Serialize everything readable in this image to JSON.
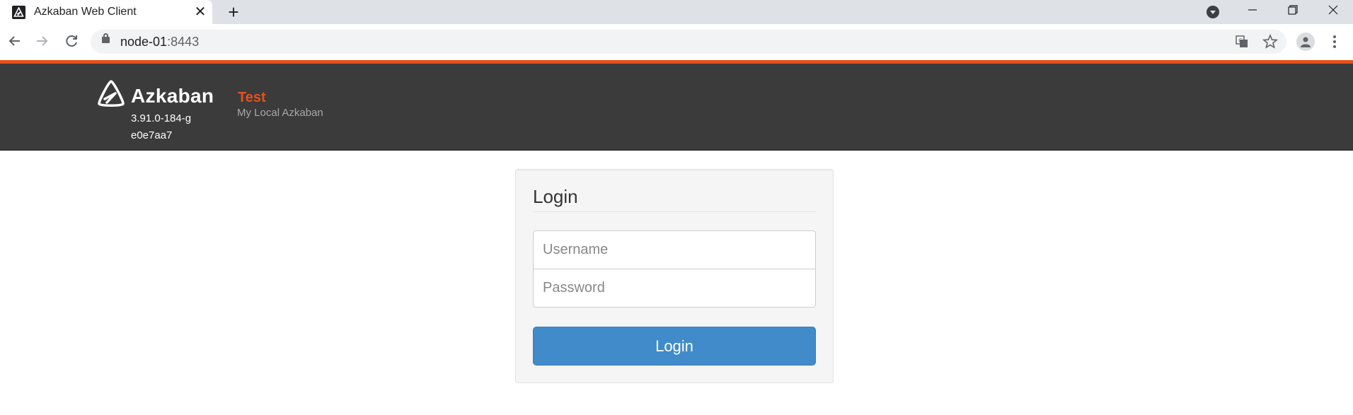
{
  "browser": {
    "tab_title": "Azkaban Web Client",
    "tab_close_glyph": "✕",
    "new_tab_glyph": "+",
    "url_host": "node-01",
    "url_port": ":8443",
    "icons": {
      "back": "back-arrow-icon",
      "forward": "forward-arrow-icon",
      "reload": "reload-icon",
      "translate": "translate-icon",
      "bookmark": "star-icon",
      "profile": "profile-icon",
      "menu": "kebab-menu-icon"
    }
  },
  "header": {
    "brand": "Azkaban",
    "version": "3.91.0-184-ge0e7aa7",
    "env_name": "Test",
    "env_description": "My Local Azkaban"
  },
  "login": {
    "title": "Login",
    "username_placeholder": "Username",
    "password_placeholder": "Password",
    "button_label": "Login"
  },
  "colors": {
    "accent_orange": "#e8501c",
    "navbar_bg": "#3b3b3b",
    "button_blue": "#428bca"
  }
}
